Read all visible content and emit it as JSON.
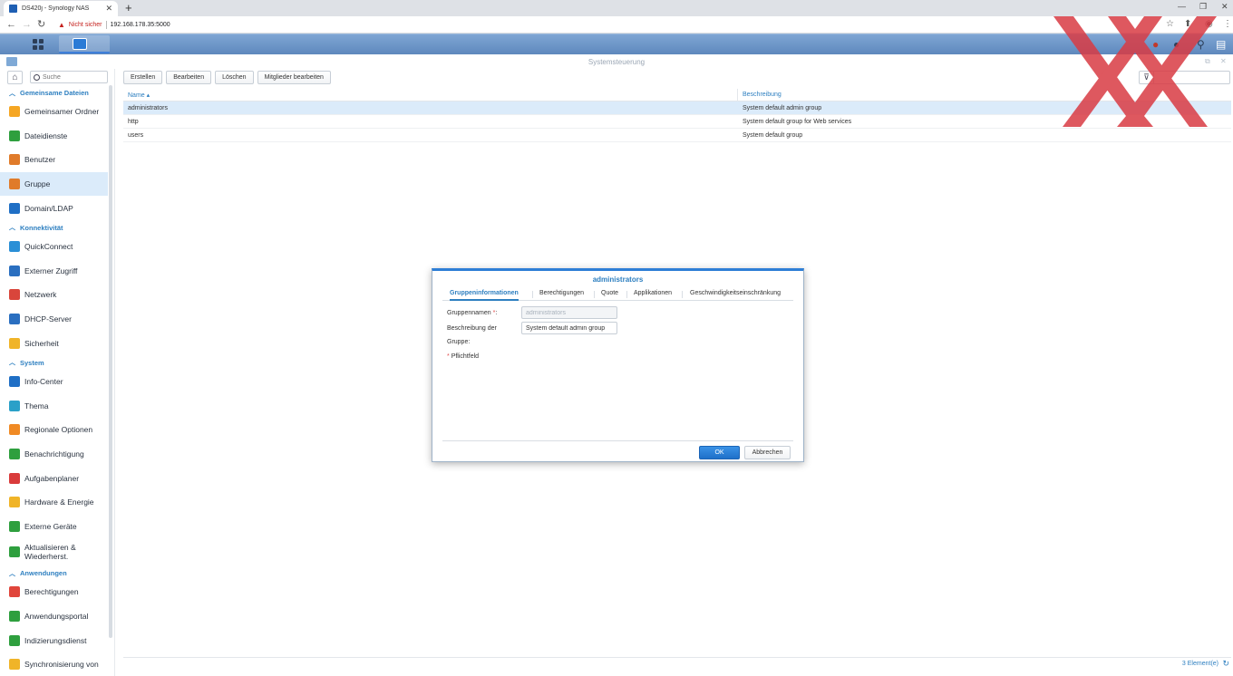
{
  "browser": {
    "tab_title": "DS420j - Synology NAS",
    "new_tab": "+",
    "security_label": "Nicht sicher",
    "url": "192.168.178.35:5000"
  },
  "window": {
    "title": "Systemsteuerung"
  },
  "sidebar": {
    "search_placeholder": "Suche",
    "sections": [
      {
        "label": "Gemeinsame Dateien",
        "items": [
          {
            "label": "Gemeinsamer Ordner",
            "icon": "shared-folder-icon",
            "color": "#f5a623"
          },
          {
            "label": "Dateidienste",
            "icon": "file-services-icon",
            "color": "#2e9f3e"
          },
          {
            "label": "Benutzer",
            "icon": "user-icon",
            "color": "#e07b2a"
          },
          {
            "label": "Gruppe",
            "icon": "group-icon",
            "color": "#e07b2a"
          },
          {
            "label": "Domain/LDAP",
            "icon": "domain-ldap-icon",
            "color": "#1f6fc5"
          }
        ]
      },
      {
        "label": "Konnektivität",
        "items": [
          {
            "label": "QuickConnect",
            "icon": "quickconnect-icon",
            "color": "#2a8fd6"
          },
          {
            "label": "Externer Zugriff",
            "icon": "external-access-icon",
            "color": "#2a6fc0"
          },
          {
            "label": "Netzwerk",
            "icon": "network-icon",
            "color": "#d9453b"
          },
          {
            "label": "DHCP-Server",
            "icon": "dhcp-server-icon",
            "color": "#2a6fc0"
          },
          {
            "label": "Sicherheit",
            "icon": "security-shield-icon",
            "color": "#f0b428"
          }
        ]
      },
      {
        "label": "System",
        "items": [
          {
            "label": "Info-Center",
            "icon": "info-center-icon",
            "color": "#1f6fc5"
          },
          {
            "label": "Thema",
            "icon": "theme-icon",
            "color": "#2aa0c8"
          },
          {
            "label": "Regionale Optionen",
            "icon": "regional-options-icon",
            "color": "#f08a24"
          },
          {
            "label": "Benachrichtigung",
            "icon": "notification-icon",
            "color": "#2e9f3e"
          },
          {
            "label": "Aufgabenplaner",
            "icon": "task-scheduler-icon",
            "color": "#d93b3b"
          },
          {
            "label": "Hardware & Energie",
            "icon": "hardware-power-icon",
            "color": "#f0b428"
          },
          {
            "label": "Externe Geräte",
            "icon": "external-devices-icon",
            "color": "#2e9f3e"
          },
          {
            "label": "Aktualisieren & Wiederherst.",
            "icon": "update-restore-icon",
            "color": "#2e9f3e"
          }
        ]
      },
      {
        "label": "Anwendungen",
        "items": [
          {
            "label": "Berechtigungen",
            "icon": "permissions-icon",
            "color": "#e0453b"
          },
          {
            "label": "Anwendungsportal",
            "icon": "application-portal-icon",
            "color": "#2e9f3e"
          },
          {
            "label": "Indizierungsdienst",
            "icon": "indexing-service-icon",
            "color": "#2e9f3e"
          },
          {
            "label": "Synchronisierung von",
            "icon": "sync-icon",
            "color": "#f0b428"
          }
        ]
      }
    ]
  },
  "toolbar": {
    "create": "Erstellen",
    "edit": "Bearbeiten",
    "delete": "Löschen",
    "edit_members": "Mitglieder bearbeiten"
  },
  "table": {
    "col_name": "Name",
    "sort_indicator": "▴",
    "col_description": "Beschreibung",
    "rows": [
      {
        "name": "administrators",
        "description": "System default admin group"
      },
      {
        "name": "http",
        "description": "System default group for Web services"
      },
      {
        "name": "users",
        "description": "System default group"
      }
    ],
    "count": "3 Element(e)"
  },
  "dialog": {
    "title": "administrators",
    "tabs": [
      "Gruppeninformationen",
      "Berechtigungen",
      "Quote",
      "Applikationen",
      "Geschwindigkeitseinschränkung"
    ],
    "group_name_label": "Gruppennamen",
    "required_star": "*",
    "group_name_suffix": ":",
    "group_name_value": "administrators",
    "description_label": "Beschreibung der",
    "description_label2": "Gruppe:",
    "description_value": "System default admin group",
    "required_note": "Pflichtfeld",
    "ok": "OK",
    "cancel": "Abbrechen"
  },
  "colors": {
    "accent": "#2d7fc0",
    "selection": "#dbebfa",
    "watermark": "#d93b44"
  }
}
